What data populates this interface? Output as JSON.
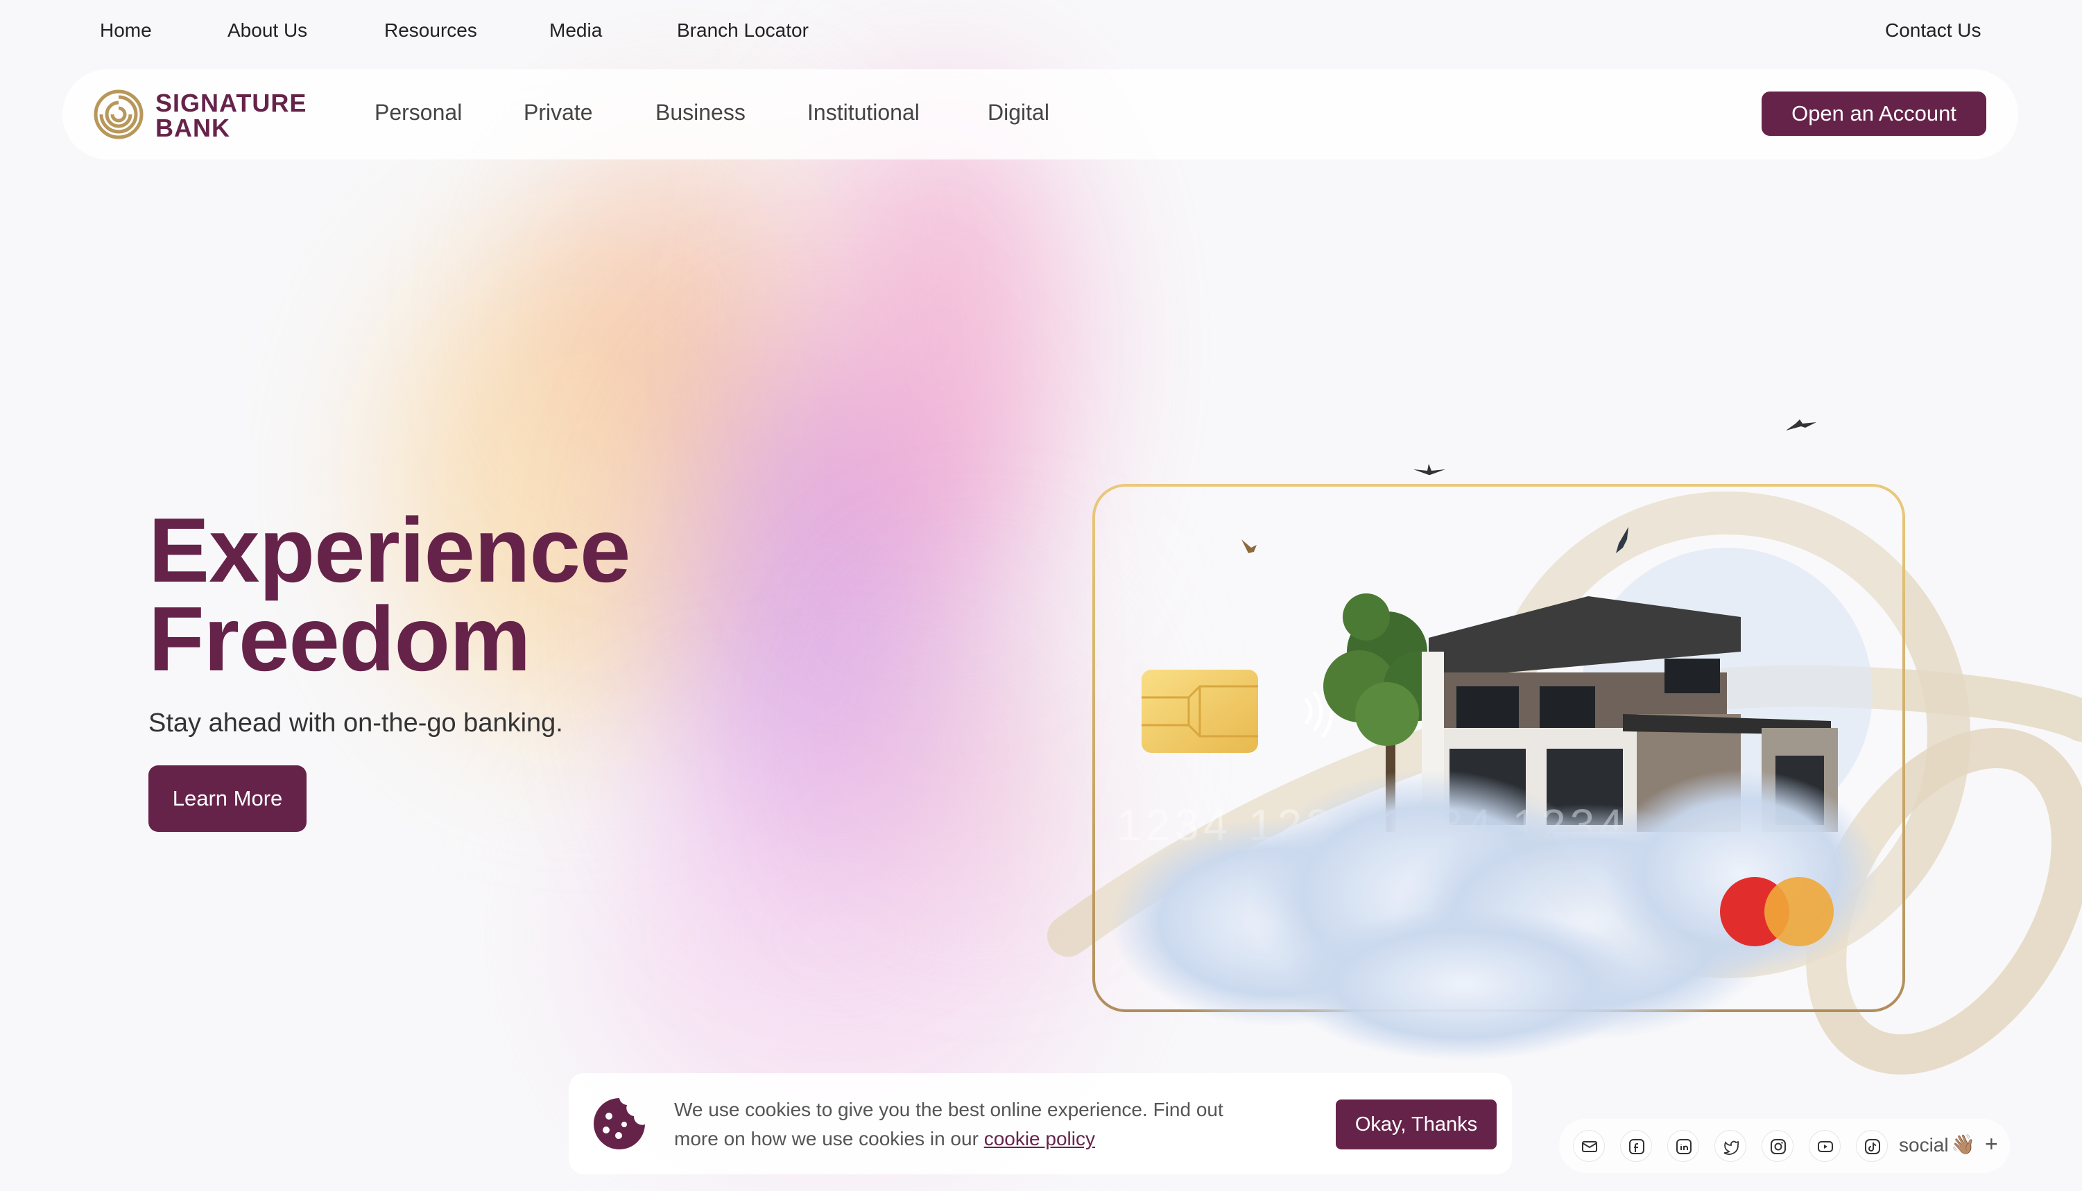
{
  "top_nav": {
    "items": [
      {
        "label": "Home"
      },
      {
        "label": "About Us"
      },
      {
        "label": "Resources"
      },
      {
        "label": "Media"
      },
      {
        "label": "Branch Locator"
      }
    ],
    "contact": "Contact Us"
  },
  "brand": {
    "line1": "SIGNATURE",
    "line2": "BANK",
    "color": "#66234a",
    "accent": "#b8975a"
  },
  "main_nav": {
    "items": [
      {
        "label": "Personal"
      },
      {
        "label": "Private"
      },
      {
        "label": "Business"
      },
      {
        "label": "Institutional"
      },
      {
        "label": "Digital"
      }
    ],
    "cta": "Open an Account"
  },
  "hero": {
    "title_line1": "Experience",
    "title_line2": "Freedom",
    "subtitle": "Stay ahead with on-the-go banking.",
    "button": "Learn More"
  },
  "card": {
    "number_hint": "1234 1234 1234 1234"
  },
  "cookie_banner": {
    "text": "We use cookies to give you the best online experience. Find out more on how we use cookies in our ",
    "link": "cookie policy",
    "button": "Okay, Thanks"
  },
  "social": {
    "icons": [
      "email-icon",
      "facebook-icon",
      "linkedin-icon",
      "twitter-icon",
      "instagram-icon",
      "youtube-icon",
      "tiktok-icon"
    ],
    "label": "social",
    "wave": "👋🏽",
    "plus": "+"
  }
}
